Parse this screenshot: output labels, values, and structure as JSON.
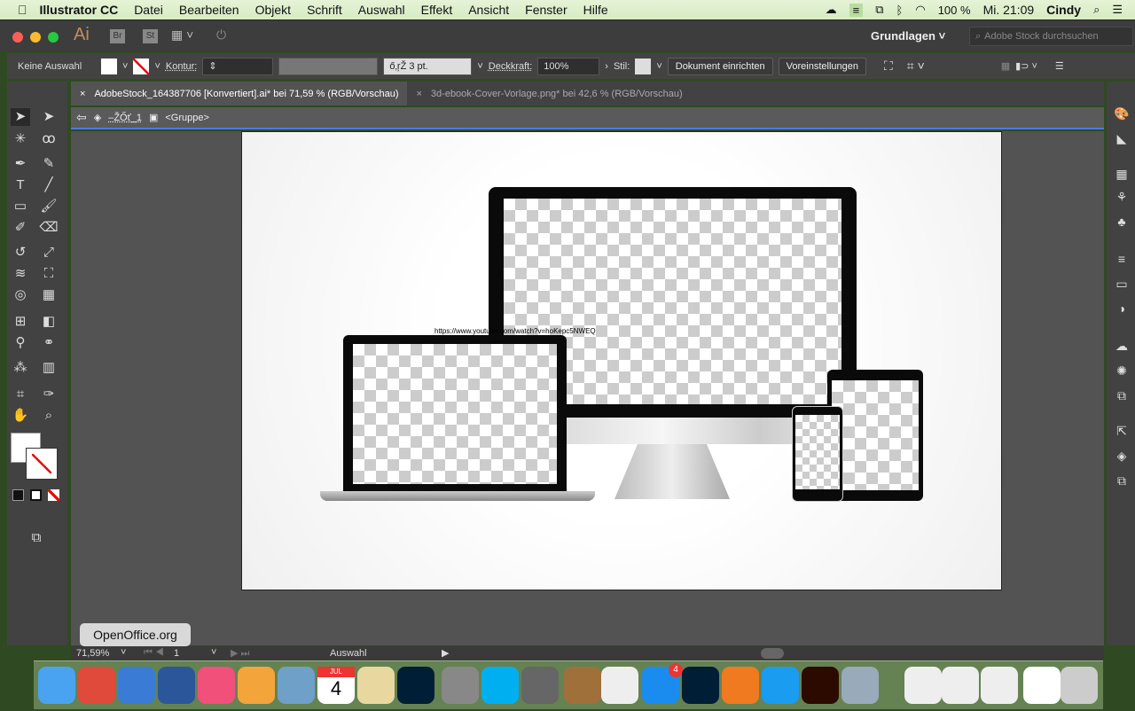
{
  "menubar": {
    "app": "Illustrator CC",
    "items": [
      "Datei",
      "Bearbeiten",
      "Objekt",
      "Schrift",
      "Auswahl",
      "Effekt",
      "Ansicht",
      "Fenster",
      "Hilfe"
    ],
    "battery": "100 %",
    "clock": "Mi. 21:09",
    "user": "Cindy"
  },
  "titlebar": {
    "logo": "Ai",
    "br": "Br",
    "st": "St",
    "workspace": "Grundlagen",
    "search_placeholder": "Adobe Stock durchsuchen"
  },
  "control": {
    "selection": "Keine Auswahl",
    "stroke_label": "Kontur:",
    "brush": "ő‚ŗŽ 3 pt.",
    "opacity_label": "Deckkraft:",
    "opacity": "100%",
    "style_label": "Stil:",
    "doc_setup": "Dokument einrichten",
    "prefs": "Voreinstellungen"
  },
  "tabs": [
    {
      "label": "AdobeStock_164387706 [Konvertiert].ai* bei 71,59 % (RGB/Vorschau)",
      "active": true
    },
    {
      "label": "3d-ebook-Cover-Vorlage.png* bei 42,6 % (RGB/Vorschau)",
      "active": false
    }
  ],
  "breadcrumb": {
    "layer": "–ŽŐť_1",
    "group": "<Gruppe>"
  },
  "artwork": {
    "url_text": "https://www.youtube.com/watch?v=hoKepc5NWEQ"
  },
  "status": {
    "zoom": "71,59%",
    "artboard": "1",
    "tool": "Auswahl"
  },
  "tooltip": "OpenOffice.org",
  "dock": {
    "items": [
      "Finder",
      "Chrome",
      "OpenOffice",
      "Word",
      "iTunes",
      "Fotos",
      "Mail",
      "Kalender",
      "Karten",
      "Photoshop",
      "Launchpad",
      "Skype",
      "Systemeinstellungen",
      "Kontakte",
      "Erinnerungen",
      "App Store",
      "Photoshop CC",
      "Brackets",
      "Safari",
      "Illustrator",
      "Vorschau",
      "Dokument",
      "Word-Dokument",
      "Word-Dokument 2",
      "Dokument leer",
      "Papierkorb"
    ],
    "calendar_month": "JUL",
    "calendar_day": "4",
    "appstore_badge": "4"
  },
  "colors": {
    "accent": "#4a7bff",
    "menubar": "#dcefc9",
    "panel": "#424242"
  }
}
